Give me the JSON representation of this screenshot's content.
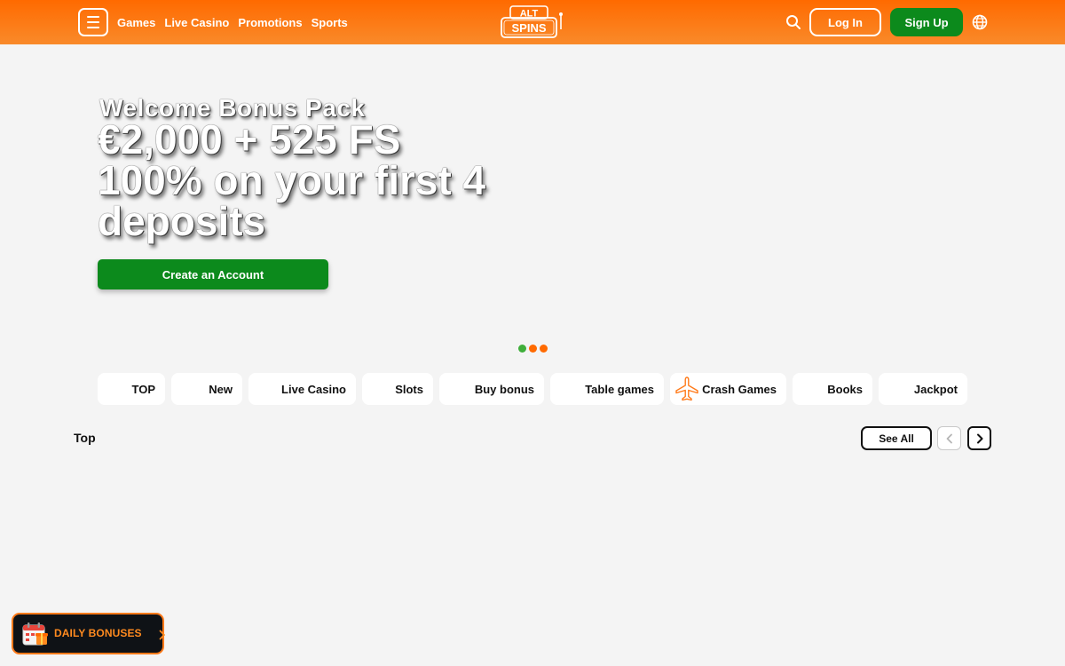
{
  "header": {
    "nav": [
      "Games",
      "Live Casino",
      "Promotions",
      "Sports"
    ],
    "logo_top": "ALT",
    "logo_bottom": "SPINS",
    "login_label": "Log In",
    "signup_label": "Sign Up"
  },
  "hero": {
    "subtitle": "Welcome Bonus Pack",
    "title_line1": "€2,000 + 525 FS",
    "title_line2": "100% on your first 4",
    "title_line3": "deposits",
    "cta_label": "Create an Account",
    "dots": [
      {
        "color": "#3fae3a",
        "active": true
      },
      {
        "color": "#ff6a00",
        "active": false
      },
      {
        "color": "#ff6a00",
        "active": false
      }
    ]
  },
  "categories": [
    "TOP",
    "New",
    "Live Casino",
    "Slots",
    "Buy bonus",
    "Table games",
    "Crash Games",
    "Books",
    "Jackpot"
  ],
  "section": {
    "title": "Top",
    "see_all_label": "See All"
  },
  "daily": {
    "label": "DAILY BONUSES"
  },
  "colors": {
    "header_orange": "#ff6a00",
    "brand_green": "#0c8a1c",
    "accent_orange": "#ff8a1f"
  }
}
